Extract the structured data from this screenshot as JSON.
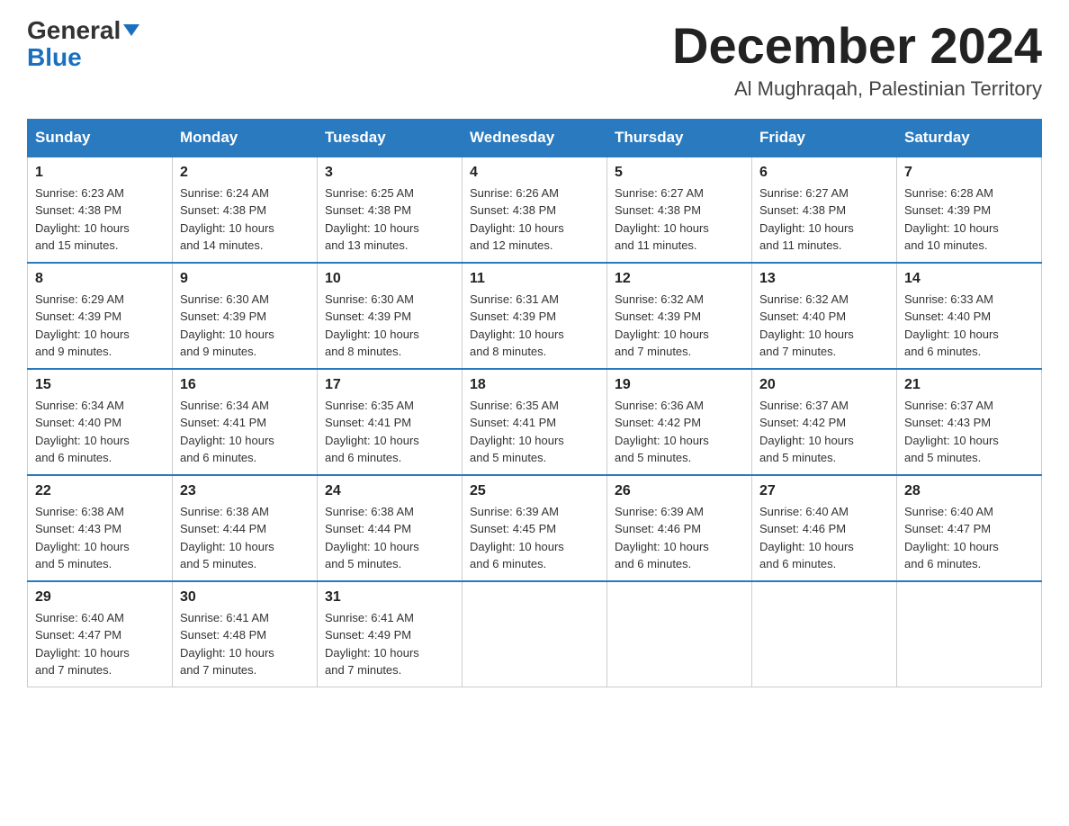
{
  "header": {
    "logo_general": "General",
    "logo_blue": "Blue",
    "month_title": "December 2024",
    "location": "Al Mughraqah, Palestinian Territory"
  },
  "days_of_week": [
    "Sunday",
    "Monday",
    "Tuesday",
    "Wednesday",
    "Thursday",
    "Friday",
    "Saturday"
  ],
  "weeks": [
    [
      {
        "day": "1",
        "sunrise": "6:23 AM",
        "sunset": "4:38 PM",
        "daylight": "10 hours and 15 minutes."
      },
      {
        "day": "2",
        "sunrise": "6:24 AM",
        "sunset": "4:38 PM",
        "daylight": "10 hours and 14 minutes."
      },
      {
        "day": "3",
        "sunrise": "6:25 AM",
        "sunset": "4:38 PM",
        "daylight": "10 hours and 13 minutes."
      },
      {
        "day": "4",
        "sunrise": "6:26 AM",
        "sunset": "4:38 PM",
        "daylight": "10 hours and 12 minutes."
      },
      {
        "day": "5",
        "sunrise": "6:27 AM",
        "sunset": "4:38 PM",
        "daylight": "10 hours and 11 minutes."
      },
      {
        "day": "6",
        "sunrise": "6:27 AM",
        "sunset": "4:38 PM",
        "daylight": "10 hours and 11 minutes."
      },
      {
        "day": "7",
        "sunrise": "6:28 AM",
        "sunset": "4:39 PM",
        "daylight": "10 hours and 10 minutes."
      }
    ],
    [
      {
        "day": "8",
        "sunrise": "6:29 AM",
        "sunset": "4:39 PM",
        "daylight": "10 hours and 9 minutes."
      },
      {
        "day": "9",
        "sunrise": "6:30 AM",
        "sunset": "4:39 PM",
        "daylight": "10 hours and 9 minutes."
      },
      {
        "day": "10",
        "sunrise": "6:30 AM",
        "sunset": "4:39 PM",
        "daylight": "10 hours and 8 minutes."
      },
      {
        "day": "11",
        "sunrise": "6:31 AM",
        "sunset": "4:39 PM",
        "daylight": "10 hours and 8 minutes."
      },
      {
        "day": "12",
        "sunrise": "6:32 AM",
        "sunset": "4:39 PM",
        "daylight": "10 hours and 7 minutes."
      },
      {
        "day": "13",
        "sunrise": "6:32 AM",
        "sunset": "4:40 PM",
        "daylight": "10 hours and 7 minutes."
      },
      {
        "day": "14",
        "sunrise": "6:33 AM",
        "sunset": "4:40 PM",
        "daylight": "10 hours and 6 minutes."
      }
    ],
    [
      {
        "day": "15",
        "sunrise": "6:34 AM",
        "sunset": "4:40 PM",
        "daylight": "10 hours and 6 minutes."
      },
      {
        "day": "16",
        "sunrise": "6:34 AM",
        "sunset": "4:41 PM",
        "daylight": "10 hours and 6 minutes."
      },
      {
        "day": "17",
        "sunrise": "6:35 AM",
        "sunset": "4:41 PM",
        "daylight": "10 hours and 6 minutes."
      },
      {
        "day": "18",
        "sunrise": "6:35 AM",
        "sunset": "4:41 PM",
        "daylight": "10 hours and 5 minutes."
      },
      {
        "day": "19",
        "sunrise": "6:36 AM",
        "sunset": "4:42 PM",
        "daylight": "10 hours and 5 minutes."
      },
      {
        "day": "20",
        "sunrise": "6:37 AM",
        "sunset": "4:42 PM",
        "daylight": "10 hours and 5 minutes."
      },
      {
        "day": "21",
        "sunrise": "6:37 AM",
        "sunset": "4:43 PM",
        "daylight": "10 hours and 5 minutes."
      }
    ],
    [
      {
        "day": "22",
        "sunrise": "6:38 AM",
        "sunset": "4:43 PM",
        "daylight": "10 hours and 5 minutes."
      },
      {
        "day": "23",
        "sunrise": "6:38 AM",
        "sunset": "4:44 PM",
        "daylight": "10 hours and 5 minutes."
      },
      {
        "day": "24",
        "sunrise": "6:38 AM",
        "sunset": "4:44 PM",
        "daylight": "10 hours and 5 minutes."
      },
      {
        "day": "25",
        "sunrise": "6:39 AM",
        "sunset": "4:45 PM",
        "daylight": "10 hours and 6 minutes."
      },
      {
        "day": "26",
        "sunrise": "6:39 AM",
        "sunset": "4:46 PM",
        "daylight": "10 hours and 6 minutes."
      },
      {
        "day": "27",
        "sunrise": "6:40 AM",
        "sunset": "4:46 PM",
        "daylight": "10 hours and 6 minutes."
      },
      {
        "day": "28",
        "sunrise": "6:40 AM",
        "sunset": "4:47 PM",
        "daylight": "10 hours and 6 minutes."
      }
    ],
    [
      {
        "day": "29",
        "sunrise": "6:40 AM",
        "sunset": "4:47 PM",
        "daylight": "10 hours and 7 minutes."
      },
      {
        "day": "30",
        "sunrise": "6:41 AM",
        "sunset": "4:48 PM",
        "daylight": "10 hours and 7 minutes."
      },
      {
        "day": "31",
        "sunrise": "6:41 AM",
        "sunset": "4:49 PM",
        "daylight": "10 hours and 7 minutes."
      },
      null,
      null,
      null,
      null
    ]
  ],
  "labels": {
    "sunrise": "Sunrise:",
    "sunset": "Sunset:",
    "daylight": "Daylight:"
  }
}
